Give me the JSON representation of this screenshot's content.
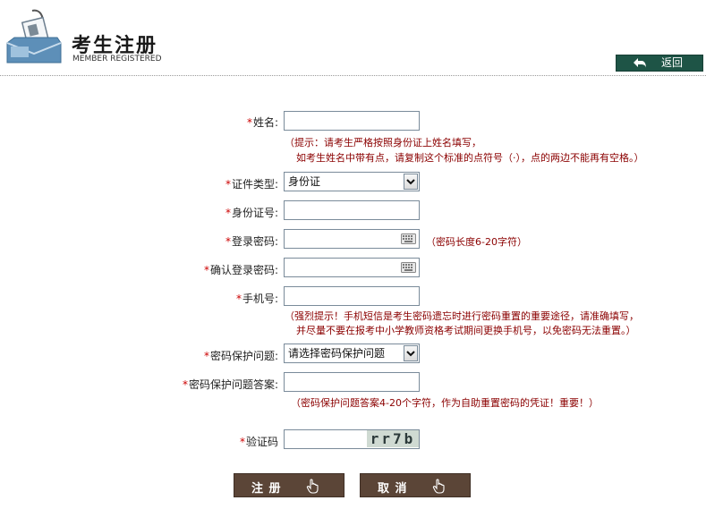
{
  "header": {
    "title": "考生注册",
    "subtitle": "MEMBER REGISTERED",
    "back_label": "返回"
  },
  "form": {
    "name": {
      "required": "*",
      "label": "姓名:",
      "value": ""
    },
    "name_hint_1": "（提示：请考生严格按照身份证上姓名填写，",
    "name_hint_2": "如考生姓名中带有点，请复制这个标准的点符号（·），点的两边不能再有空格。）",
    "id_type": {
      "required": "*",
      "label": "证件类型:",
      "selected": "身份证"
    },
    "id_number": {
      "required": "*",
      "label": "身份证号:",
      "value": ""
    },
    "password": {
      "required": "*",
      "label": "登录密码:",
      "value": ""
    },
    "password_hint": "（密码长度6-20字符）",
    "confirm_password": {
      "required": "*",
      "label": "确认登录密码:",
      "value": ""
    },
    "phone": {
      "required": "*",
      "label": "手机号:",
      "value": ""
    },
    "phone_hint_1": "（强烈提示！手机短信是考生密码遗忘时进行密码重置的重要途径，请准确填写，",
    "phone_hint_2": "并尽量不要在报考中小学教师资格考试期间更换手机号，以免密码无法重置。）",
    "security_question": {
      "required": "*",
      "label": "密码保护问题:",
      "selected": "请选择密码保护问题"
    },
    "security_answer": {
      "required": "*",
      "label": "密码保护问题答案:",
      "value": ""
    },
    "answer_hint": "（密码保护问题答案4-20个字符，作为自助重置密码的凭证！重要！）",
    "captcha": {
      "required": "*",
      "label": "验证码",
      "image_text": "rr7b"
    }
  },
  "actions": {
    "register_label": "注 册",
    "cancel_label": "取 消"
  },
  "icons": {
    "logo": "registration-badge-icon",
    "back": "return-arrow-icon",
    "keyboard": "soft-keyboard-icon",
    "cursor": "hand-pointer-icon"
  },
  "colors": {
    "required_mark": "#cc0000",
    "hint_text": "#8b0000",
    "back_button": "#1e5446",
    "action_button": "#5b4537"
  }
}
